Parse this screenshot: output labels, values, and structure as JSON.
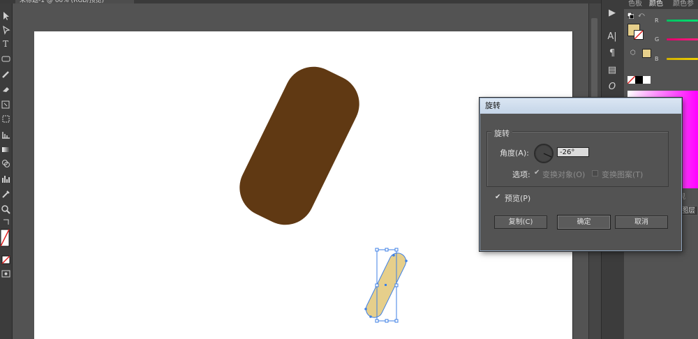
{
  "document": {
    "tab_title": "未标题-1 @ 66% (RGB/预览)"
  },
  "colors": {
    "brown_fill": "#603913",
    "tan_fill": "#e6cf8b",
    "selection": "#3d7fe6",
    "current_fill": "#e6cf8b"
  },
  "toolbar": {
    "icons": [
      "selection-tool-icon",
      "direct-selection-tool-icon",
      "type-tool-icon",
      "rectangle-tool-icon",
      "pencil-tool-icon",
      "eraser-tool-icon",
      "rotate-tool-icon",
      "width-tool-icon",
      "graph-tool-icon",
      "gradient-tool-icon",
      "shape-builder-tool-icon",
      "column-graph-tool-icon",
      "eyedropper-tool-icon",
      "zoom-tool-icon",
      "swap-colors-icon",
      "fill-stroke-icon",
      "none-color-icon",
      "screen-mode-icon"
    ]
  },
  "color_panel": {
    "tabs": [
      "色板",
      "颜色",
      "颜色参"
    ],
    "channels": [
      "R",
      "G",
      "B"
    ]
  },
  "layers_panel": {
    "view_tab": "观",
    "layers_tab": "图层"
  },
  "rotate_dialog": {
    "title": "旋转",
    "group_title": "旋转",
    "angle_label": "角度(A):",
    "angle_value": "-26°",
    "options_label": "选项:",
    "option_transform_objects": "变换对象(O)",
    "option_transform_patterns": "变换图案(T)",
    "preview_label": "预览(P)",
    "copy_button": "复制(C)",
    "ok_button": "确定",
    "cancel_button": "取消"
  }
}
